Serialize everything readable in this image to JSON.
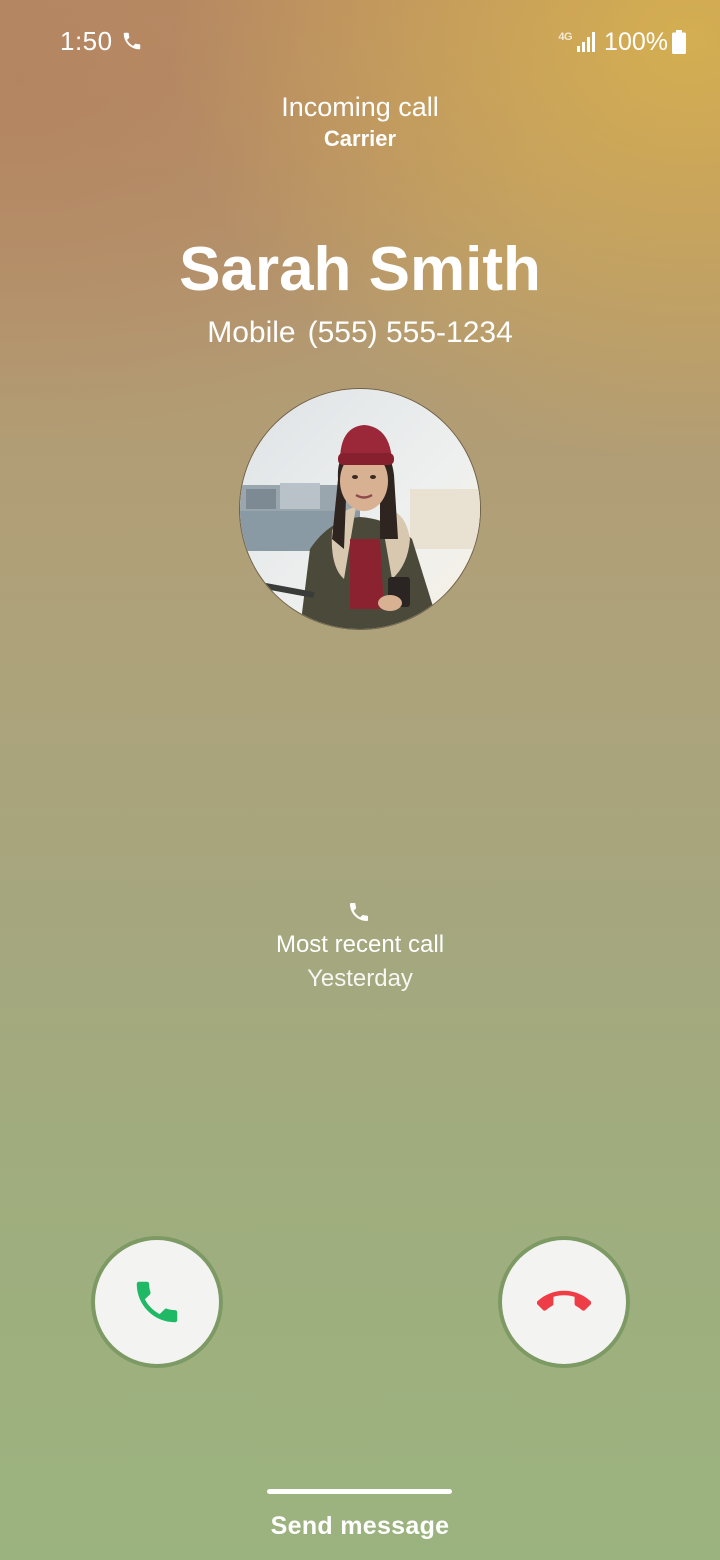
{
  "status_bar": {
    "time": "1:50",
    "network": "4G",
    "battery": "100%"
  },
  "call": {
    "status": "Incoming call",
    "carrier": "Carrier"
  },
  "caller": {
    "name": "Sarah Smith",
    "number_type": "Mobile",
    "number": "(555) 555-1234"
  },
  "recent_call": {
    "label": "Most recent call",
    "when": "Yesterday"
  },
  "actions": {
    "send_message": "Send message"
  },
  "colors": {
    "accept": "#1fb865",
    "decline": "#ee3d46",
    "button_bg": "#f3f3f1"
  }
}
